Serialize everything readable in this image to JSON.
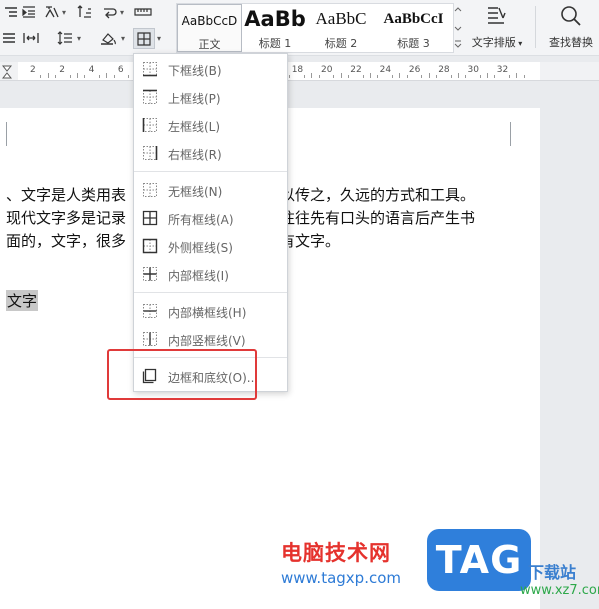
{
  "styles": [
    {
      "sample": "AaBbCcD",
      "name": "正文",
      "active": true
    },
    {
      "sample": "AaBb",
      "name": "标题 1"
    },
    {
      "sample": "AaBbC",
      "name": "标题 2"
    },
    {
      "sample": "AaBbCcI",
      "name": "标题 3"
    }
  ],
  "tools": {
    "text_layout": "文字排版",
    "find_replace": "查找替换"
  },
  "ruler": {
    "numbers": [
      "2",
      "2",
      "4",
      "6",
      "8",
      "10",
      "12",
      "14",
      "16",
      "18",
      "20",
      "22",
      "24",
      "26",
      "28",
      "30",
      "32"
    ]
  },
  "document": {
    "lines": [
      "、文字是人类用表",
      "现代文字多是记录",
      "面的，文字，很多"
    ],
    "lines_right": [
      "以传之，久远的方式和工具。",
      "往往先有口头的语言后产生书",
      "有文字。"
    ],
    "selected_word": "文字"
  },
  "menu": {
    "items": [
      {
        "label": "下框线(B)",
        "icon": "border-bottom-icon"
      },
      {
        "label": "上框线(P)",
        "icon": "border-top-icon"
      },
      {
        "label": "左框线(L)",
        "icon": "border-left-icon"
      },
      {
        "label": "右框线(R)",
        "icon": "border-right-icon"
      },
      {
        "label": "无框线(N)",
        "icon": "border-none-icon"
      },
      {
        "label": "所有框线(A)",
        "icon": "border-all-icon"
      },
      {
        "label": "外侧框线(S)",
        "icon": "border-outside-icon"
      },
      {
        "label": "内部框线(I)",
        "icon": "border-inside-icon"
      },
      {
        "label": "内部横框线(H)",
        "icon": "border-inside-horizontal-icon"
      },
      {
        "label": "内部竖框线(V)",
        "icon": "border-inside-vertical-icon"
      },
      {
        "label": "边框和底纹(O)...",
        "icon": "borders-shading-icon"
      }
    ]
  },
  "watermark": {
    "site_name": "电脑技术网",
    "url": "www.tagxp.com",
    "tag": "TAG",
    "right_text": "下载站",
    "right_url": "www.xz7.com"
  },
  "colors": {
    "highlight": "#e03a3a",
    "watermark_red": "#e5322d",
    "watermark_blue": "#2f7fdb"
  }
}
